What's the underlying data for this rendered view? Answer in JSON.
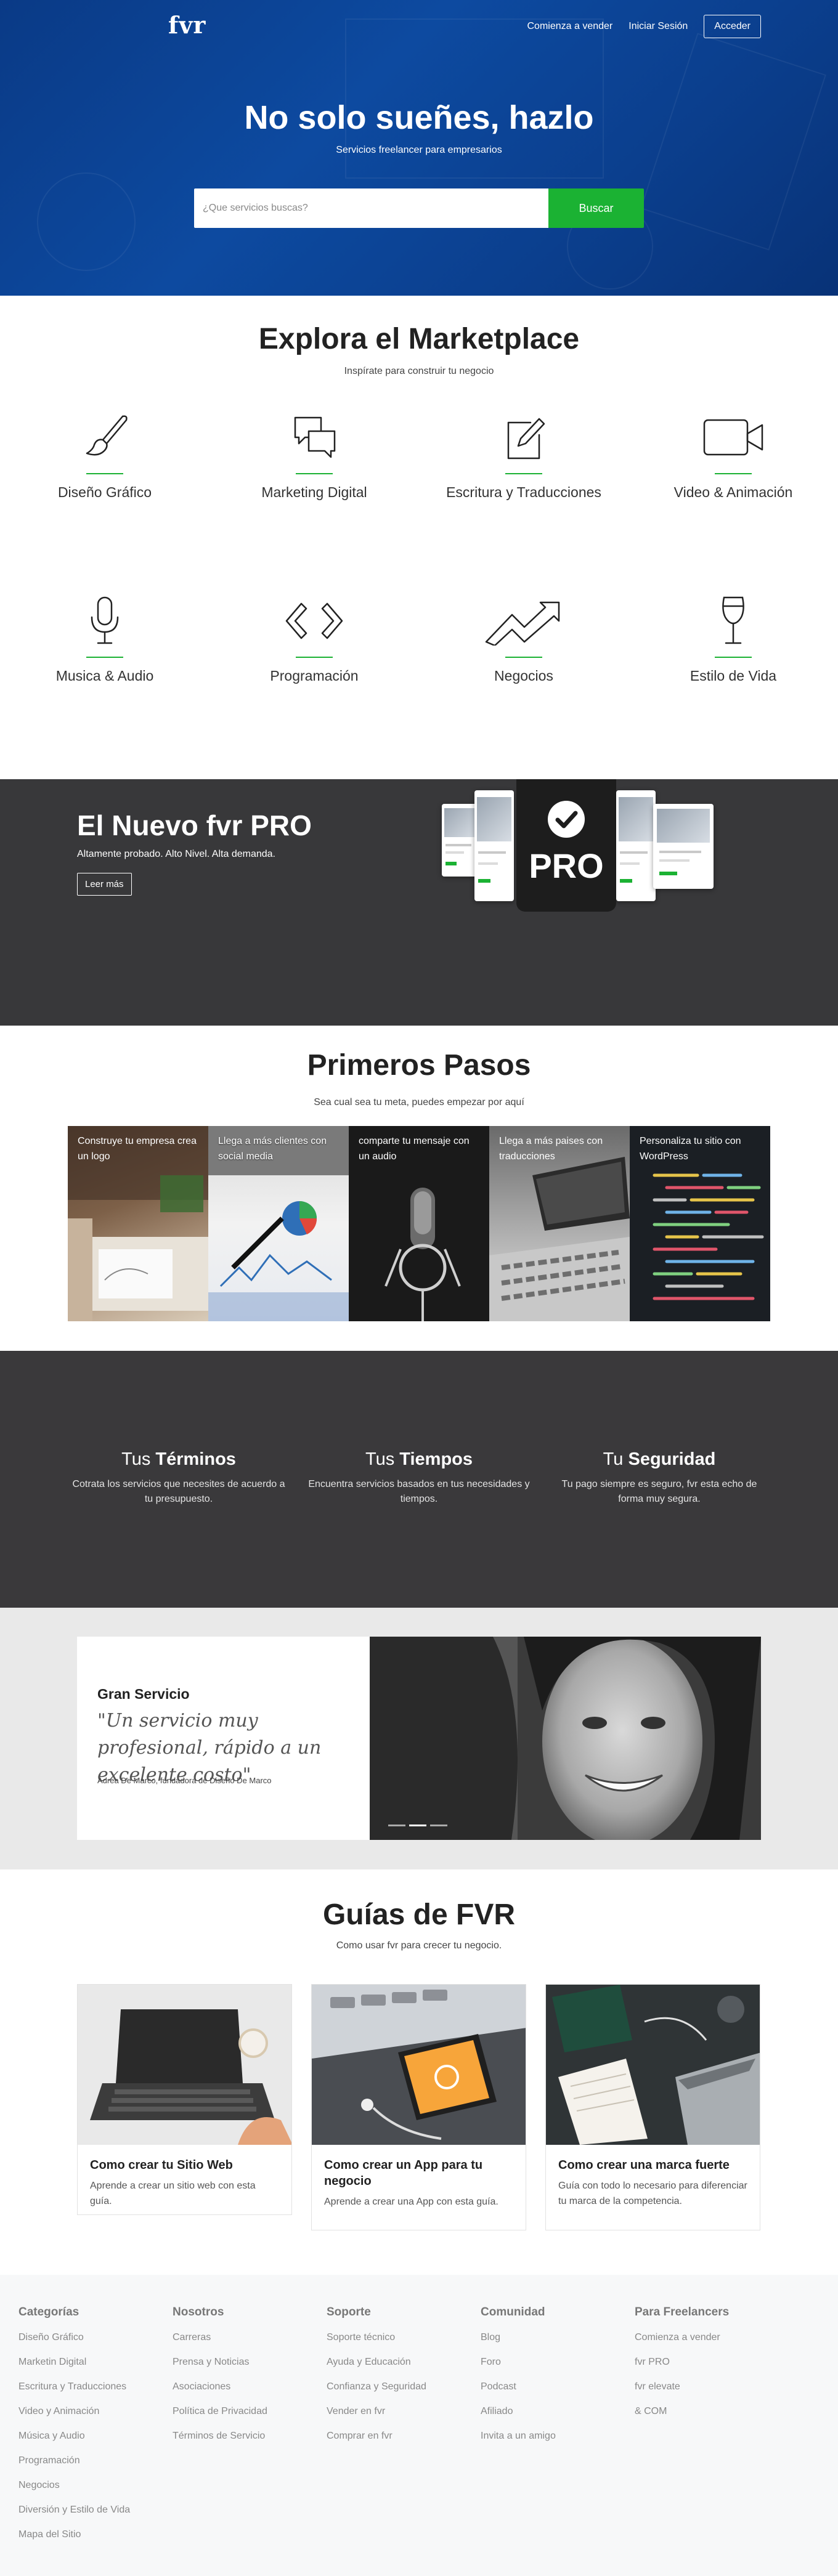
{
  "header": {
    "logo": "fvr",
    "nav": [
      "Comienza a vender",
      "Iniciar Sesión"
    ],
    "login_button": "Acceder"
  },
  "hero": {
    "title": "No solo sueñes, hazlo",
    "subtitle": "Servicios freelancer para empresarios",
    "search_placeholder": "¿Que servicios buscas?",
    "search_button": "Buscar"
  },
  "marketplace": {
    "title": "Explora el Marketplace",
    "subtitle": "Inspírate para construir tu negocio",
    "categories": [
      {
        "label": "Diseño Gráfico",
        "icon": "brush-icon"
      },
      {
        "label": "Marketing Digital",
        "icon": "chat-bubbles-icon"
      },
      {
        "label": "Escritura y Traducciones",
        "icon": "pencil-square-icon"
      },
      {
        "label": "Video & Animación",
        "icon": "video-camera-icon"
      },
      {
        "label": "Musica & Audio",
        "icon": "microphone-icon"
      },
      {
        "label": "Programación",
        "icon": "code-icon"
      },
      {
        "label": "Negocios",
        "icon": "trend-up-icon"
      },
      {
        "label": "Estilo de Vida",
        "icon": "wine-glass-icon"
      }
    ]
  },
  "pro": {
    "title": "El Nuevo fvr PRO",
    "tagline": "Altamente probado. Alto Nivel. Alta demanda.",
    "button": "Leer más",
    "badge": "PRO"
  },
  "primeros": {
    "title": "Primeros Pasos",
    "subtitle": "Sea cual sea tu meta, puedes empezar por aquí",
    "tiles": [
      "Construye tu empresa crea un logo",
      "Llega a más clientes con social media",
      "comparte tu mensaje con un audio",
      "Llega a más paises con traducciones",
      "Personaliza tu sitio con WordPress"
    ]
  },
  "features": [
    {
      "pre": "Tus ",
      "bold": "Términos",
      "text": "Cotrata los servicios que necesites de acuerdo a tu presupuesto."
    },
    {
      "pre": "Tus ",
      "bold": "Tiempos",
      "text": "Encuentra servicios basados en tus necesidades y tiempos."
    },
    {
      "pre": "Tu ",
      "bold": "Seguridad",
      "text": "Tu pago siempre es seguro, fvr esta echo de forma muy segura."
    }
  ],
  "testimonial": {
    "title": "Gran Servicio",
    "quote": "\"Un servicio muy profesional, rápido a un excelente costo\"",
    "author": "Adrea De Marco, fundadora de Diseño De Marco"
  },
  "guias": {
    "title": "Guías de FVR",
    "subtitle": "Como usar fvr para crecer tu negocio.",
    "items": [
      {
        "title": "Como crear tu Sitio Web",
        "desc": "Aprende a crear un sitio web con esta guía."
      },
      {
        "title": "Como crear un App para tu negocio",
        "desc": "Aprende a crear una App con esta guía."
      },
      {
        "title": "Como crear una marca fuerte",
        "desc": "Guía con todo lo necesario para diferenciar tu marca de la competencia."
      }
    ]
  },
  "footer": {
    "columns": [
      {
        "title": "Categorías",
        "links": [
          "Diseño Gráfico",
          "Marketin Digital",
          "Escritura y Traducciones",
          "Video y Animación",
          "Música y Audio",
          "Programación",
          "Negocios",
          "Diversión y Estilo de Vida",
          "Mapa del Sitio"
        ]
      },
      {
        "title": "Nosotros",
        "links": [
          "Carreras",
          "Prensa y Noticias",
          "Asociaciones",
          "Política de Privacidad",
          "Términos de Servicio"
        ]
      },
      {
        "title": "Soporte",
        "links": [
          "Soporte técnico",
          "Ayuda y Educación",
          "Confianza y Seguridad",
          "Vender en fvr",
          "Comprar en fvr"
        ]
      },
      {
        "title": "Comunidad",
        "links": [
          "Blog",
          "Foro",
          "Podcast",
          "Afiliado",
          "Invita a un amigo"
        ]
      },
      {
        "title": "Para Freelancers",
        "links": [
          "Comienza a vender",
          "fvr PRO",
          "fvr elevate",
          "& COM"
        ]
      }
    ]
  },
  "colors": {
    "hero_blue": "#0d4aa0",
    "accent_green": "#1bb233",
    "dark_section": "#38383a"
  }
}
